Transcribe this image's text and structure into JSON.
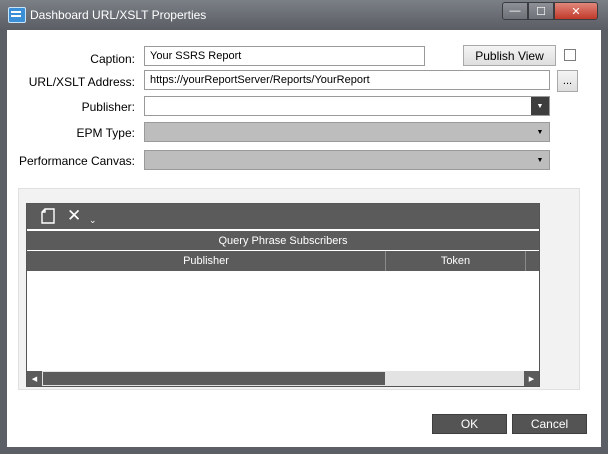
{
  "window": {
    "title": "Dashboard URL/XSLT Properties",
    "min_glyph": "—",
    "max_glyph": "☐",
    "close_glyph": "✕"
  },
  "form": {
    "caption_label": "Caption:",
    "caption_value": "Your SSRS Report",
    "publish_view_label": "Publish View",
    "publish_view_checked": false,
    "url_label": "URL/XSLT Address:",
    "url_value": "https://yourReportServer/Reports/YourReport",
    "browse_label": "...",
    "publisher_label": "Publisher:",
    "publisher_value": "",
    "epm_type_label": "EPM Type:",
    "epm_type_value": "",
    "performance_canvas_label": "Performance Canvas:",
    "performance_canvas_value": ""
  },
  "grid": {
    "caption": "Query Phrase Subscribers",
    "columns": [
      "Publisher",
      "Token"
    ],
    "rows": []
  },
  "icons": {
    "new": "new-document-icon",
    "delete": "delete-x-icon",
    "dropdown": "chevron-down-icon"
  },
  "footer": {
    "ok_label": "OK",
    "cancel_label": "Cancel"
  }
}
